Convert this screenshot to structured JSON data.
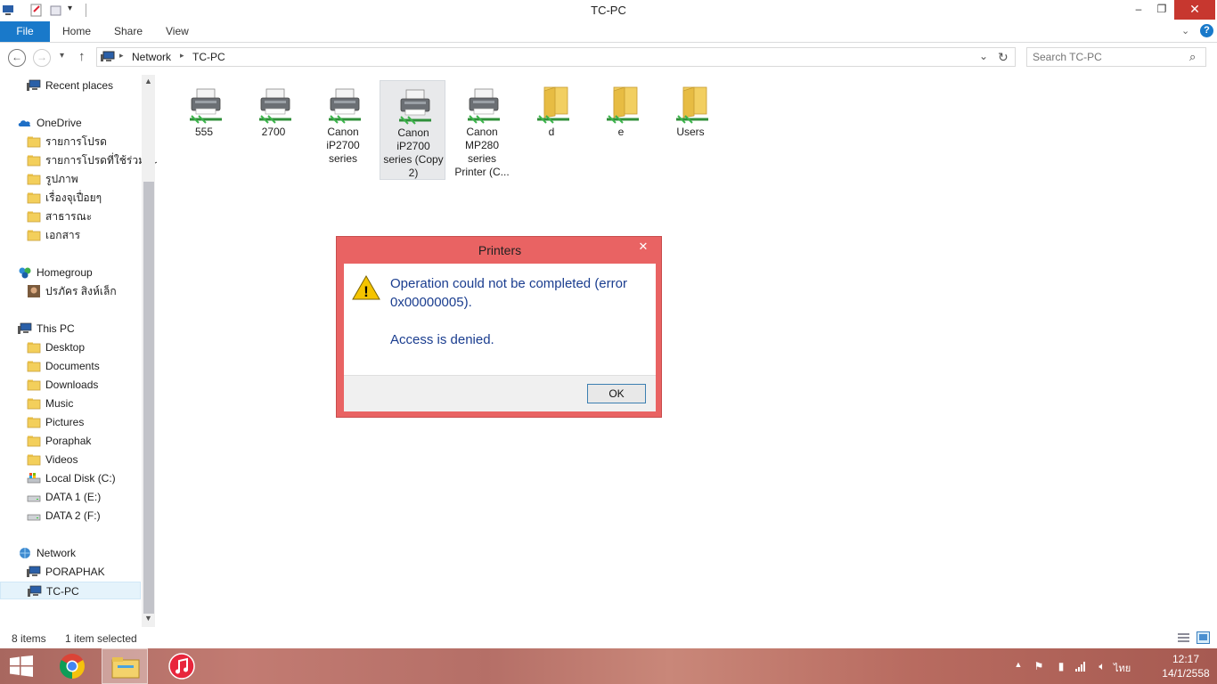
{
  "window": {
    "title": "TC-PC",
    "minimize": "–",
    "restore": "❐",
    "close": "✕"
  },
  "ribbon": {
    "tabs": [
      "File",
      "Home",
      "Share",
      "View"
    ],
    "help": "?"
  },
  "address": {
    "crumbs": [
      "Network",
      "TC-PC"
    ],
    "search_placeholder": "Search TC-PC"
  },
  "nav": {
    "items": [
      {
        "label": "Recent places",
        "icon": "recent-places-icon"
      },
      {
        "label": "OneDrive",
        "icon": "onedrive-icon"
      },
      {
        "label": "รายการโปรด",
        "icon": "folder-icon"
      },
      {
        "label": "รายการโปรดที่ใช้ร่วมกัน",
        "icon": "folder-icon"
      },
      {
        "label": "รูปภาพ",
        "icon": "folder-icon"
      },
      {
        "label": "เรื่องจุเปื่อยๆ",
        "icon": "folder-icon"
      },
      {
        "label": "สาธารณะ",
        "icon": "folder-icon"
      },
      {
        "label": "เอกสาร",
        "icon": "folder-icon"
      },
      {
        "label": "Homegroup",
        "icon": "homegroup-icon"
      },
      {
        "label": "ปรภัคร สิงห์เล็ก",
        "icon": "user-avatar-icon"
      },
      {
        "label": "This PC",
        "icon": "this-pc-icon"
      },
      {
        "label": "Desktop",
        "icon": "desktop-folder-icon"
      },
      {
        "label": "Documents",
        "icon": "documents-folder-icon"
      },
      {
        "label": "Downloads",
        "icon": "downloads-folder-icon"
      },
      {
        "label": "Music",
        "icon": "music-folder-icon"
      },
      {
        "label": "Pictures",
        "icon": "pictures-folder-icon"
      },
      {
        "label": "Poraphak",
        "icon": "user-folder-icon"
      },
      {
        "label": "Videos",
        "icon": "videos-folder-icon"
      },
      {
        "label": "Local Disk (C:)",
        "icon": "local-disk-icon"
      },
      {
        "label": "DATA 1 (E:)",
        "icon": "drive-icon"
      },
      {
        "label": "DATA 2 (F:)",
        "icon": "drive-icon"
      },
      {
        "label": "Network",
        "icon": "network-icon"
      },
      {
        "label": "PORAPHAK",
        "icon": "computer-icon"
      },
      {
        "label": "TC-PC",
        "icon": "computer-icon"
      }
    ]
  },
  "content": {
    "items": [
      {
        "name": "555",
        "type": "printer"
      },
      {
        "name": "2700",
        "type": "printer"
      },
      {
        "name": "Canon iP2700 series",
        "type": "printer"
      },
      {
        "name": "Canon iP2700 series (Copy 2)",
        "type": "printer",
        "selected": true
      },
      {
        "name": "Canon MP280 series Printer (C...",
        "type": "printer"
      },
      {
        "name": "d",
        "type": "shared-folder"
      },
      {
        "name": "e",
        "type": "shared-folder"
      },
      {
        "name": "Users",
        "type": "shared-folder"
      }
    ]
  },
  "status": {
    "count": "8 items",
    "selection": "1 item selected"
  },
  "dialog": {
    "title": "Printers",
    "close": "✕",
    "message_line1": "Operation could not be completed (error",
    "message_line2": "0x00000005).",
    "message_line3": "Access is denied.",
    "ok_label": "OK",
    "warning_icon": "!"
  },
  "taskbar": {
    "clock_time": "12:17",
    "clock_date": "14/1/2558",
    "language": "ไทย"
  },
  "colors": {
    "accent": "#1979ca",
    "dialog_border": "#e96363",
    "dialog_text": "#1a3d8f",
    "close_button": "#c7372f"
  }
}
